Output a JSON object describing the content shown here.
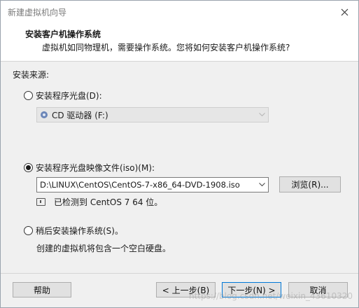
{
  "window": {
    "title": "新建虚拟机向导"
  },
  "header": {
    "title": "安装客户机操作系统",
    "subtitle": "虚拟机如同物理机，需要操作系统。您将如何安装客户机操作系统?"
  },
  "source": {
    "label": "安装来源:",
    "disc_option": {
      "label": "安装程序光盘(D):",
      "selected": false,
      "drive_value": "CD 驱动器 (F:)",
      "enabled": false
    },
    "iso_option": {
      "label": "安装程序光盘映像文件(iso)(M):",
      "selected": true,
      "path_value": "D:\\LINUX\\CentOS\\CentOS-7-x86_64-DVD-1908.iso",
      "browse_label": "浏览(R)...",
      "detected_text": "已检测到 CentOS 7 64 位。"
    },
    "later_option": {
      "label": "稍后安装操作系统(S)。",
      "selected": false,
      "description": "创建的虚拟机将包含一个空白硬盘。"
    }
  },
  "footer": {
    "help_label": "帮助",
    "back_label": "< 上一步(B)",
    "next_label": "下一步(N) >",
    "cancel_label": "取消"
  },
  "watermark": "https://blog.csdn.net/weixin_43610320",
  "icons": {
    "close": "close-icon",
    "dropdown": "chevron-down-icon",
    "disc": "cd-drive-icon",
    "info": "info-icon"
  }
}
